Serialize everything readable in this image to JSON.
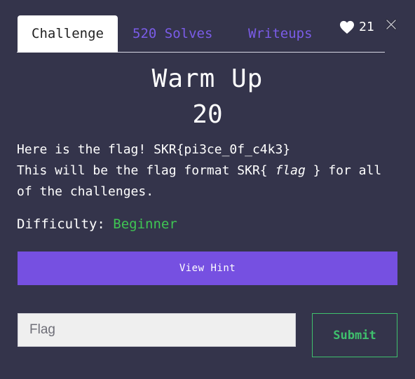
{
  "tabs": {
    "challenge": "Challenge",
    "solves": "520 Solves",
    "writeups": "Writeups"
  },
  "likes": {
    "count": "21"
  },
  "challenge": {
    "name": "Warm Up",
    "points": "20",
    "description": {
      "line1": "Here is the flag! SKR{pi3ce_0f_c4k3}",
      "line2_prefix": "This will be the flag format SKR{ ",
      "line2_em": "flag",
      "line2_suffix": " } for all",
      "line3": "of the challenges."
    },
    "difficulty_label": "Difficulty:",
    "difficulty_value": "Beginner"
  },
  "hint_button": {
    "label": "View Hint"
  },
  "flag_form": {
    "placeholder": "Flag",
    "submit_label": "Submit"
  },
  "colors": {
    "background": "#34344b",
    "accent_purple": "#7650e1",
    "success_green": "#3fc06d"
  }
}
